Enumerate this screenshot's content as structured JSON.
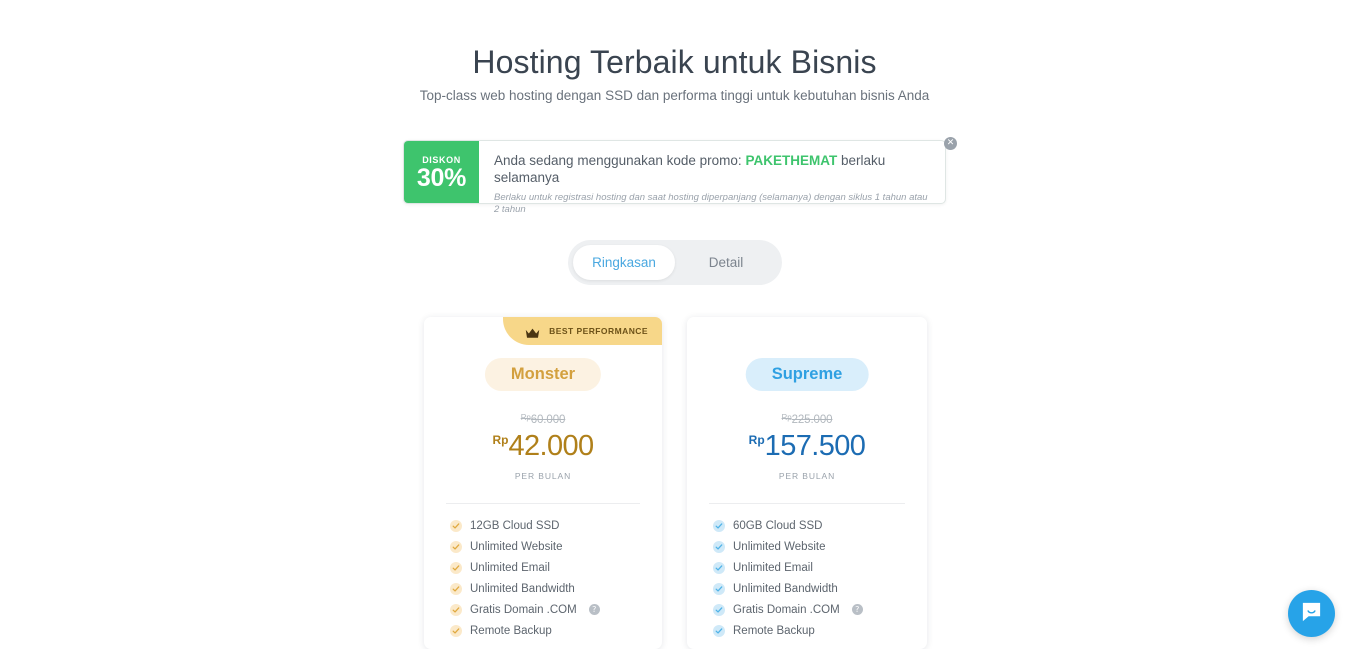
{
  "header": {
    "title": "Hosting Terbaik untuk Bisnis",
    "subtitle": "Top-class web hosting dengan SSD dan performa tinggi untuk kebutuhan bisnis Anda"
  },
  "promo": {
    "discount_label": "DISKON",
    "discount_value": "30%",
    "message_prefix": "Anda sedang menggunakan kode promo:",
    "code": "PAKETHEMAT",
    "message_suffix": "berlaku selamanya",
    "fine_print": "Berlaku untuk registrasi hosting dan saat hosting diperpanjang (selamanya) dengan siklus 1 tahun atau 2 tahun",
    "close_icon": "close-icon",
    "accent_color": "#3ec46d"
  },
  "tabs": {
    "items": [
      {
        "label": "Ringkasan",
        "active": true
      },
      {
        "label": "Detail",
        "active": false
      }
    ],
    "active_color": "#4aa8e0"
  },
  "plans": [
    {
      "id": "monster",
      "badge": {
        "label": "BEST PERFORMANCE",
        "icon": "crown-icon"
      },
      "name": "Monster",
      "currency": "Rp",
      "price_old": "60.000",
      "price_new": "42.000",
      "period": "PER BULAN",
      "price_color": "#b0801a",
      "pill_bg": "#fcf2e2",
      "features": [
        {
          "label": "12GB Cloud SSD",
          "help": false
        },
        {
          "label": "Unlimited Website",
          "help": false
        },
        {
          "label": "Unlimited Email",
          "help": false
        },
        {
          "label": "Unlimited Bandwidth",
          "help": false
        },
        {
          "label": "Gratis Domain .COM",
          "help": true
        },
        {
          "label": "Remote Backup",
          "help": false
        }
      ]
    },
    {
      "id": "supreme",
      "badge": null,
      "name": "Supreme",
      "currency": "Rp",
      "price_old": "225.000",
      "price_new": "157.500",
      "period": "PER BULAN",
      "price_color": "#1c6cb3",
      "pill_bg": "#d9eefb",
      "features": [
        {
          "label": "60GB Cloud SSD",
          "help": false
        },
        {
          "label": "Unlimited Website",
          "help": false
        },
        {
          "label": "Unlimited Email",
          "help": false
        },
        {
          "label": "Unlimited Bandwidth",
          "help": false
        },
        {
          "label": "Gratis Domain .COM",
          "help": true
        },
        {
          "label": "Remote Backup",
          "help": false
        }
      ]
    }
  ],
  "chat": {
    "icon": "chat-bubble-icon",
    "color": "#27a3e8"
  },
  "help_icon_glyph": "?"
}
